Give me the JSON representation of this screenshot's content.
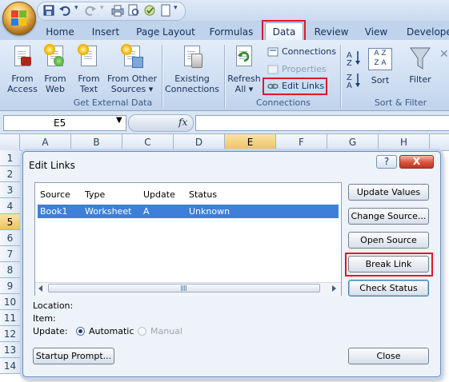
{
  "ribbon_tabs": [
    "Home",
    "Insert",
    "Page Layout",
    "Formulas",
    "Data",
    "Review",
    "View",
    "Develope"
  ],
  "active_tab": "Data",
  "groups": {
    "external": {
      "label": "Get External Data",
      "buttons": [
        {
          "line1": "From",
          "line2": "Access"
        },
        {
          "line1": "From",
          "line2": "Web"
        },
        {
          "line1": "From",
          "line2": "Text"
        },
        {
          "line1": "From Other",
          "line2": "Sources ▾"
        },
        {
          "line1": "Existing",
          "line2": "Connections"
        }
      ]
    },
    "connections": {
      "label": "Connections",
      "refresh_line1": "Refresh",
      "refresh_line2": "All ▾",
      "connections": "Connections",
      "properties": "Properties",
      "edit_links": "Edit Links"
    },
    "sort": {
      "label": "Sort & Filter",
      "sort": "Sort",
      "filter": "Filter"
    }
  },
  "formula_bar": {
    "name_box": "E5",
    "fx": "fx",
    "formula": ""
  },
  "columns": [
    "A",
    "B",
    "C",
    "D",
    "E",
    "F",
    "G",
    "H"
  ],
  "rows": [
    "1",
    "2",
    "3",
    "4",
    "5",
    "6",
    "7",
    "8",
    "9",
    "10",
    "11",
    "12",
    "13",
    "14"
  ],
  "selected_cell": {
    "column": "E",
    "row": "5"
  },
  "dialog": {
    "title": "Edit Links",
    "help": "?",
    "close": "X",
    "columns": [
      "Source",
      "Type",
      "Update",
      "Status"
    ],
    "links": [
      {
        "source": "Book1",
        "type": "Worksheet",
        "update": "A",
        "status": "Unknown"
      }
    ],
    "location_label": "Location:",
    "item_label": "Item:",
    "update_label": "Update:",
    "automatic": "Automatic",
    "manual": "Manual",
    "update_mode": "Automatic",
    "buttons": {
      "update_values": "Update Values",
      "change_source": "Change Source...",
      "open_source": "Open Source",
      "break_link": "Break Link",
      "check_status": "Check Status",
      "startup_prompt": "Startup Prompt...",
      "close": "Close"
    }
  },
  "colors": {
    "highlight": "#e0172b",
    "selection": "#3d7fd9",
    "ribbon": "#c7d9ef"
  }
}
